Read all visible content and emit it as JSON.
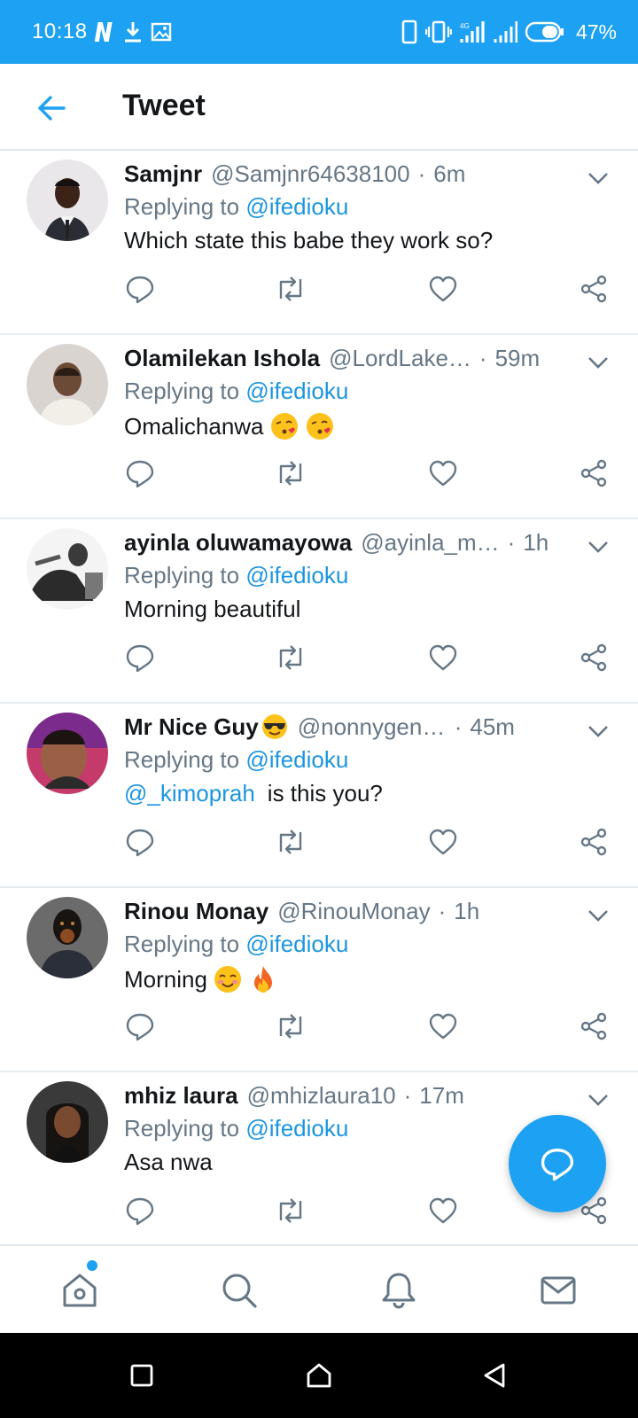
{
  "status_bar": {
    "time": "10:18",
    "battery": "47%"
  },
  "header": {
    "title": "Tweet"
  },
  "tweets": [
    {
      "name": "Samjnr",
      "handle": "@Samjnr64638100",
      "time": "6m",
      "replying_label": "Replying to",
      "replying_to": "@ifedioku",
      "text": "Which state this babe they work so?"
    },
    {
      "name": "Olamilekan Ishola",
      "handle": "@LordLake…",
      "time": "59m",
      "replying_label": "Replying to",
      "replying_to": "@ifedioku",
      "text": "Omalichanwa",
      "emojis": [
        "kissing-face",
        "kissing-face"
      ]
    },
    {
      "name": "ayinla oluwamayowa",
      "handle": "@ayinla_m…",
      "time": "1h",
      "replying_label": "Replying to",
      "replying_to": "@ifedioku",
      "text": "Morning beautiful"
    },
    {
      "name": "Mr Nice Guy",
      "name_emoji": "sunglasses-face",
      "handle": "@nonnygentle…",
      "time": "45m",
      "replying_label": "Replying to",
      "replying_to": "@ifedioku",
      "mention": "@_kimoprah",
      "text": "is this you?"
    },
    {
      "name": "Rinou Monay",
      "handle": "@RinouMonay",
      "time": "1h",
      "replying_label": "Replying to",
      "replying_to": "@ifedioku",
      "text": "Morning",
      "emojis": [
        "smiling-blushing-face",
        "fire"
      ]
    },
    {
      "name": "mhiz laura",
      "handle": "@mhizlaura10",
      "time": "17m",
      "replying_label": "Replying to",
      "replying_to": "@ifedioku",
      "text": "Asa nwa"
    }
  ],
  "icons": {
    "back": "arrow-left-icon",
    "reply": "reply-icon",
    "retweet": "retweet-icon",
    "like": "heart-icon",
    "share": "share-icon",
    "compose": "compose-reply-icon",
    "home": "home-icon",
    "search": "search-icon",
    "notifications": "bell-icon",
    "messages": "mail-icon"
  },
  "colors": {
    "brand": "#1da1f2",
    "link": "#1b95e0",
    "muted": "#657786",
    "text": "#14171a"
  }
}
